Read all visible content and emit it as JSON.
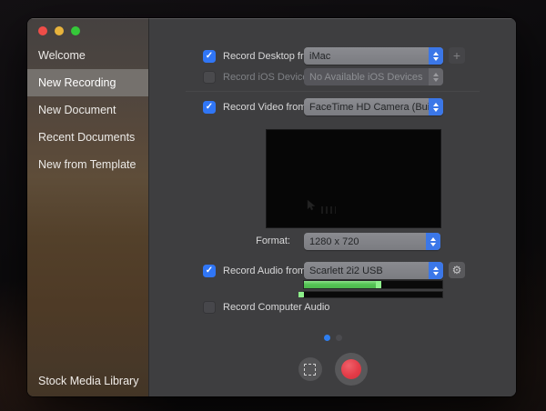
{
  "window": {
    "traffic_lights": [
      "close",
      "minimize",
      "zoom"
    ]
  },
  "sidebar": {
    "items": [
      {
        "label": "Welcome",
        "selected": false
      },
      {
        "label": "New Recording",
        "selected": true
      },
      {
        "label": "New Document",
        "selected": false
      },
      {
        "label": "Recent Documents",
        "selected": false
      },
      {
        "label": "New from Template",
        "selected": false
      }
    ],
    "footer_item": {
      "label": "Stock Media Library"
    }
  },
  "main": {
    "rows": {
      "desktop": {
        "checked": true,
        "label": "Record Desktop from:",
        "value": "iMac"
      },
      "ios": {
        "checked": false,
        "disabled": true,
        "label": "Record iOS Device:",
        "value": "No Available iOS Devices"
      },
      "video": {
        "checked": true,
        "label": "Record Video from:",
        "value": "FaceTime HD Camera (Built-in)"
      },
      "format": {
        "label": "Format:",
        "value": "1280 x 720"
      },
      "audio": {
        "checked": true,
        "label": "Record Audio from:",
        "value": "Scarlett 2i2 USB"
      },
      "computer_audio": {
        "checked": false,
        "label": "Record Computer Audio"
      }
    },
    "audio_meter": {
      "left_level_percent": 56,
      "right_level_percent": 0
    },
    "pager": {
      "dot_count": 2,
      "active_index": 0
    }
  },
  "glyphs": {
    "check": "✓",
    "plus": "+",
    "gear": "⚙"
  },
  "colors": {
    "accent_blue": "#3b77e8",
    "checkbox_blue": "#3076f6",
    "record_red": "#e23c48",
    "meter_green": "#55c455",
    "traffic_red": "#ef4d48",
    "traffic_yellow": "#e8b33c",
    "traffic_green": "#35c839",
    "panel_bg": "#3e3e40",
    "sidebar_brown": "#4e3a26"
  }
}
